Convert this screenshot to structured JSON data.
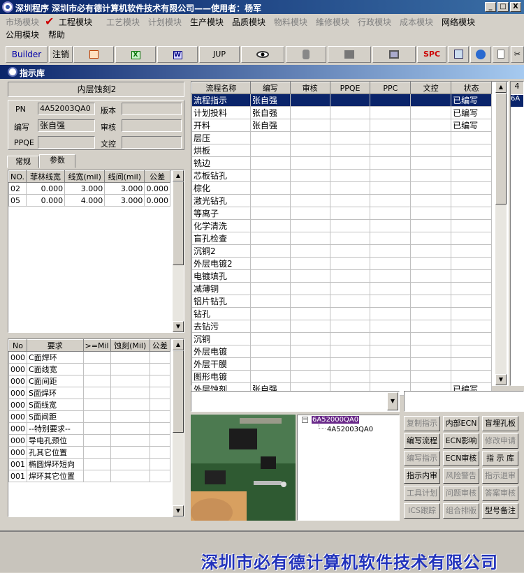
{
  "window": {
    "title": "深圳程序    深圳市必有德计算机软件技术有限公司——使用者：杨军",
    "min": "_",
    "max": "□",
    "close": "X"
  },
  "menu": {
    "row1": [
      {
        "label": "市场模块",
        "enabled": false
      },
      {
        "label": "工程模块",
        "enabled": true
      },
      {
        "label": "工艺模块",
        "enabled": false
      },
      {
        "label": "计划模块",
        "enabled": false
      },
      {
        "label": "生产模块",
        "enabled": true
      },
      {
        "label": "品质模块",
        "enabled": true
      },
      {
        "label": "物料模块",
        "enabled": false
      },
      {
        "label": "維修模块",
        "enabled": false
      },
      {
        "label": "行政模块",
        "enabled": false
      },
      {
        "label": "成本模块",
        "enabled": false
      },
      {
        "label": "网络模块",
        "enabled": true
      }
    ],
    "row2": [
      {
        "label": "公用模块"
      },
      {
        "label": "帮助"
      }
    ]
  },
  "toolbar": {
    "builder": "Builder",
    "logout": "注销",
    "jup": "JUP",
    "spc": "SPC"
  },
  "subwindow": {
    "title": "指示库"
  },
  "left": {
    "board_name": "内层蚀刻2",
    "pn_label": "PN",
    "pn_value": "4A52003QA0",
    "version_label": "版本",
    "version_value": "",
    "author_label": "编写",
    "author_value": "张自强",
    "review_label": "审核",
    "review_value": "",
    "ppqe_label": "PPQE",
    "ppqe_value": "",
    "doc_label": "文控",
    "doc_value": "",
    "tab_normal": "常规",
    "tab_params": "参数",
    "params_headers": [
      "NO.",
      "菲林线宽",
      "线宽(mil)",
      "线间(mil)",
      "公差"
    ],
    "params_rows": [
      [
        "02",
        "0.000",
        "3.000",
        "3.000",
        "0.000"
      ],
      [
        "05",
        "0.000",
        "4.000",
        "3.000",
        "0.000"
      ]
    ],
    "req_headers": [
      "No",
      "要求",
      ">=Mil",
      "蚀刻(Mil)",
      "公差"
    ],
    "req_rows": [
      [
        "000",
        "C面焊环"
      ],
      [
        "000",
        "C面线宽"
      ],
      [
        "000",
        "C面间距"
      ],
      [
        "000",
        "S面焊环"
      ],
      [
        "000",
        "S面线宽"
      ],
      [
        "000",
        "S面间距"
      ],
      [
        "000",
        "--特别要求--"
      ],
      [
        "000",
        "导电孔颈位"
      ],
      [
        "000",
        "孔其它位置"
      ],
      [
        "001",
        "椭圆焊环短向"
      ],
      [
        "001",
        "焊环其它位置"
      ]
    ]
  },
  "process": {
    "headers": [
      "流程名称",
      "编写",
      "审核",
      "PPQE",
      "PPC",
      "文控",
      "状态"
    ],
    "rows": [
      [
        "流程指示",
        "张自强",
        "",
        "",
        "",
        "",
        "已编写"
      ],
      [
        "计划投料",
        "张自强",
        "",
        "",
        "",
        "",
        "已编写"
      ],
      [
        "开料",
        "张自强",
        "",
        "",
        "",
        "",
        "已编写"
      ],
      [
        "层压",
        "",
        "",
        "",
        "",
        "",
        ""
      ],
      [
        "烘板",
        "",
        "",
        "",
        "",
        "",
        ""
      ],
      [
        "铣边",
        "",
        "",
        "",
        "",
        "",
        ""
      ],
      [
        "芯板钻孔",
        "",
        "",
        "",
        "",
        "",
        ""
      ],
      [
        "棕化",
        "",
        "",
        "",
        "",
        "",
        ""
      ],
      [
        "激光钻孔",
        "",
        "",
        "",
        "",
        "",
        ""
      ],
      [
        "等离子",
        "",
        "",
        "",
        "",
        "",
        ""
      ],
      [
        "化学清洗",
        "",
        "",
        "",
        "",
        "",
        ""
      ],
      [
        "盲孔检查",
        "",
        "",
        "",
        "",
        "",
        ""
      ],
      [
        "沉铜2",
        "",
        "",
        "",
        "",
        "",
        ""
      ],
      [
        "外层电镀2",
        "",
        "",
        "",
        "",
        "",
        ""
      ],
      [
        "电镀填孔",
        "",
        "",
        "",
        "",
        "",
        ""
      ],
      [
        "减薄铜",
        "",
        "",
        "",
        "",
        "",
        ""
      ],
      [
        "铝片钻孔",
        "",
        "",
        "",
        "",
        "",
        ""
      ],
      [
        "钻孔",
        "",
        "",
        "",
        "",
        "",
        ""
      ],
      [
        "去钻污",
        "",
        "",
        "",
        "",
        "",
        ""
      ],
      [
        "沉铜",
        "",
        "",
        "",
        "",
        "",
        ""
      ],
      [
        "外层电镀",
        "",
        "",
        "",
        "",
        "",
        ""
      ],
      [
        "外层干膜",
        "",
        "",
        "",
        "",
        "",
        ""
      ],
      [
        "图形电镀",
        "",
        "",
        "",
        "",
        "",
        ""
      ],
      [
        "外层蚀刻",
        "张自强",
        "",
        "",
        "",
        "",
        "已编写"
      ]
    ],
    "right_header": "4",
    "right_cell": "6A"
  },
  "tree": {
    "root": "6A52000QA0",
    "child": "4A52003QA0"
  },
  "actions": [
    {
      "label": "复制指示",
      "enabled": false
    },
    {
      "label": "内部ECN",
      "enabled": true
    },
    {
      "label": "盲埋孔板",
      "enabled": true
    },
    {
      "label": "编写流程",
      "enabled": true
    },
    {
      "label": "ECN影响",
      "enabled": true
    },
    {
      "label": "修改申请",
      "enabled": false
    },
    {
      "label": "编写指示",
      "enabled": false
    },
    {
      "label": "ECN审核",
      "enabled": true
    },
    {
      "label": "指 示 库",
      "enabled": true
    },
    {
      "label": "指示内审",
      "enabled": true
    },
    {
      "label": "风险警告",
      "enabled": false
    },
    {
      "label": "指示退审",
      "enabled": false
    },
    {
      "label": "工具计划",
      "enabled": false
    },
    {
      "label": "问题审核",
      "enabled": false
    },
    {
      "label": "答案审核",
      "enabled": false
    },
    {
      "label": "ICS跟踪",
      "enabled": false
    },
    {
      "label": "组合排版",
      "enabled": false
    },
    {
      "label": "型号备注",
      "enabled": true
    }
  ],
  "footer": {
    "company": "深圳市必有德计算机软件技术有限公司"
  }
}
